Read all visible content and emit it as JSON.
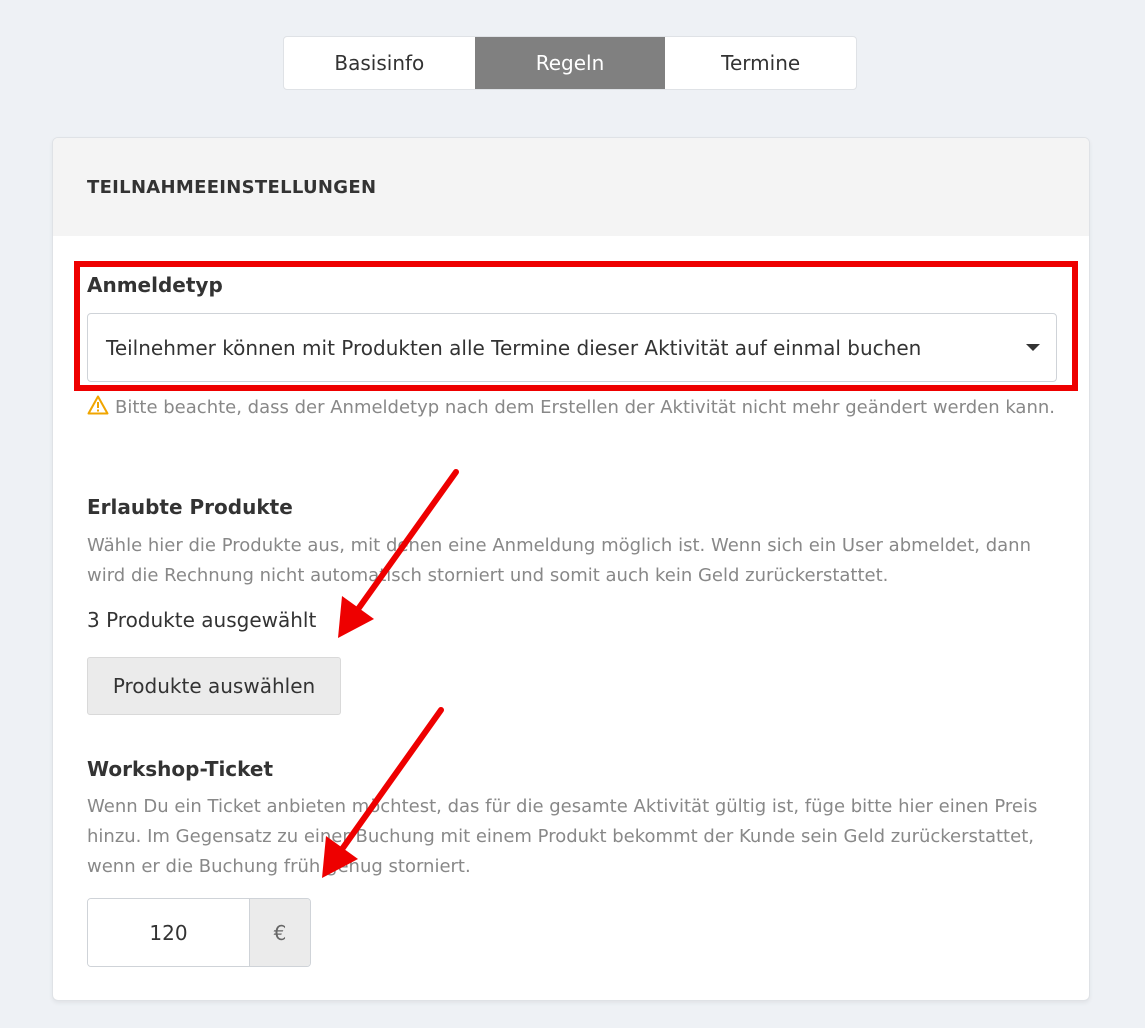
{
  "tabs": [
    {
      "label": "Basisinfo",
      "active": false
    },
    {
      "label": "Regeln",
      "active": true
    },
    {
      "label": "Termine",
      "active": false
    }
  ],
  "section": {
    "title": "TEILNAHMEEINSTELLUNGEN"
  },
  "registration": {
    "label": "Anmeldetyp",
    "selected": "Teilnehmer können mit Produkten alle Termine dieser Aktivität auf einmal buchen",
    "warning": "Bitte beachte, dass der Anmeldetyp nach dem Erstellen der Aktivität nicht mehr geändert werden kann."
  },
  "products": {
    "label": "Erlaubte Produkte",
    "help": "Wähle hier die Produkte aus, mit denen eine Anmeldung möglich ist. Wenn sich ein User abmeldet, dann wird die Rechnung nicht automatisch storniert und somit auch kein Geld zurückerstattet.",
    "count_text": "3 Produkte ausgewählt",
    "button_label": "Produkte auswählen"
  },
  "ticket": {
    "label": "Workshop-Ticket",
    "help": "Wenn Du ein Ticket anbieten möchtest, das für die gesamte Aktivität gültig ist, füge bitte hier einen Preis hinzu. Im Gegensatz zu einer Buchung mit einem Produkt bekommt der Kunde sein Geld zurückerstattet, wenn er die Buchung früh genug storniert.",
    "price": "120",
    "currency": "€"
  },
  "colors": {
    "annotation": "#ee0000",
    "active_tab": "#808080",
    "warning_icon": "#f0a500"
  },
  "icons": {
    "warning": "warning-triangle-icon",
    "dropdown": "caret-down-icon",
    "annotation_arrow": "red-arrow-icon"
  }
}
